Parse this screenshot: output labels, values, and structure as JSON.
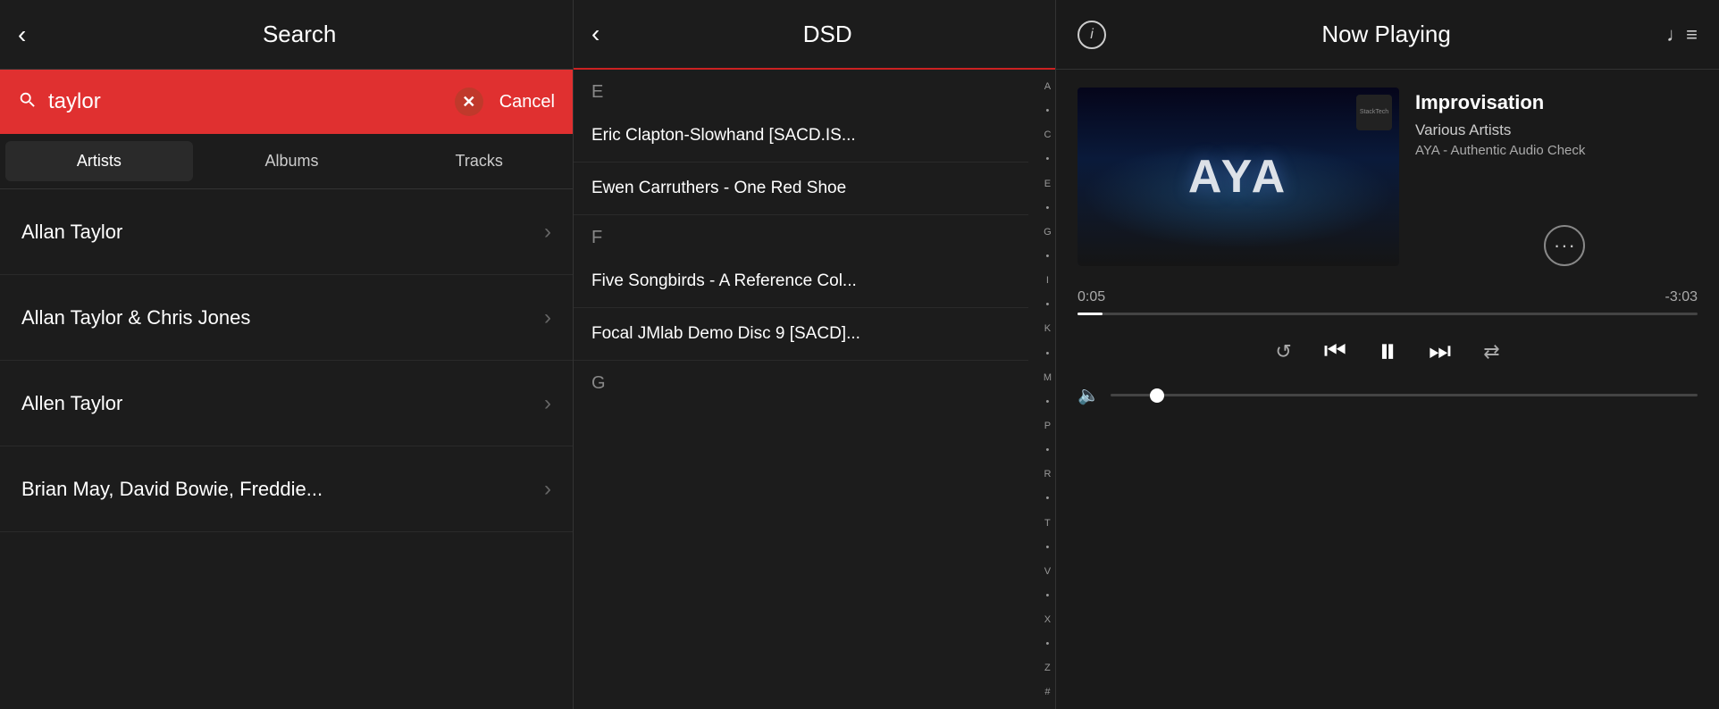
{
  "search_panel": {
    "back_label": "‹",
    "title": "Search",
    "search_value": "taylor",
    "cancel_label": "Cancel",
    "filters": [
      {
        "label": "Artists",
        "active": true
      },
      {
        "label": "Albums",
        "active": false
      },
      {
        "label": "Tracks",
        "active": false
      }
    ],
    "artists": [
      {
        "name": "Allan Taylor"
      },
      {
        "name": "Allan Taylor & Chris Jones"
      },
      {
        "name": "Allen Taylor"
      },
      {
        "name": "Brian May, David Bowie, Freddie..."
      }
    ]
  },
  "dsd_panel": {
    "back_label": "‹",
    "title": "DSD",
    "sections": [
      {
        "header": "E",
        "items": [
          {
            "label": "Eric Clapton-Slowhand [SACD.IS..."
          },
          {
            "label": "Ewen Carruthers - One Red Shoe"
          }
        ]
      },
      {
        "header": "F",
        "items": [
          {
            "label": "Five Songbirds - A Reference Col..."
          },
          {
            "label": "Focal JMlab Demo Disc 9 [SACD]..."
          }
        ]
      },
      {
        "header": "G",
        "items": []
      }
    ],
    "alphabet": [
      "A",
      "•",
      "C",
      "•",
      "E",
      "•",
      "G",
      "•",
      "I",
      "•",
      "K",
      "•",
      "M",
      "•",
      "P",
      "•",
      "R",
      "•",
      "T",
      "•",
      "V",
      "•",
      "X",
      "•",
      "Z",
      "#"
    ]
  },
  "now_playing": {
    "title": "Now Playing",
    "info_icon": "i",
    "track_name": "Improvisation",
    "artist": "Various Artists",
    "album": "AYA - Authentic Audio Check",
    "aya_text": "AYA",
    "logo_text": "StackTech",
    "time_elapsed": "0:05",
    "time_remaining": "-3:03",
    "progress_pct": 4,
    "controls": {
      "repeat": "↺",
      "prev": "⏮",
      "pause": "⏸",
      "next": "⏭",
      "shuffle": "⇄"
    },
    "more_label": "···"
  }
}
